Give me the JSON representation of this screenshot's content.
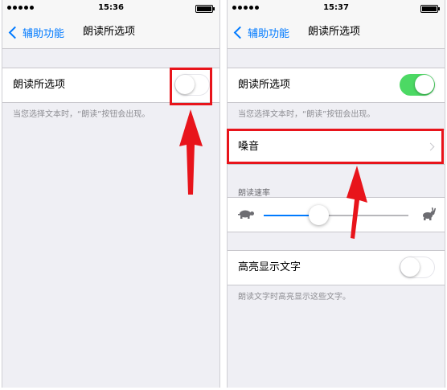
{
  "left_screen": {
    "status_time": "15:36",
    "back_label": "辅助功能",
    "title": "朗读所选项",
    "speak_selection": {
      "label": "朗读所选项",
      "on": false
    },
    "speak_selection_footnote": "当您选择文本时，“朗读”按钮会出现。"
  },
  "right_screen": {
    "status_time": "15:37",
    "back_label": "辅助功能",
    "title": "朗读所选项",
    "speak_selection": {
      "label": "朗读所选项",
      "on": true
    },
    "speak_selection_footnote": "当您选择文本时，“朗读”按钮会出现。",
    "voices_label": "嗓音",
    "speaking_rate_header": "朗读速率",
    "speaking_rate": 0.38,
    "highlight_words": {
      "label": "高亮显示文字",
      "on": false
    },
    "highlight_words_footnote": "朗读文字时高亮显示这些文字。"
  },
  "colors": {
    "accent_blue": "#007aff",
    "switch_on_green": "#4cd964",
    "annotation_red": "#e8141b"
  },
  "icons": [
    "signal-dots-icon",
    "battery-icon",
    "back-chevron-icon",
    "chevron-right-icon",
    "turtle-icon",
    "hare-icon",
    "red-arrow-icon"
  ]
}
